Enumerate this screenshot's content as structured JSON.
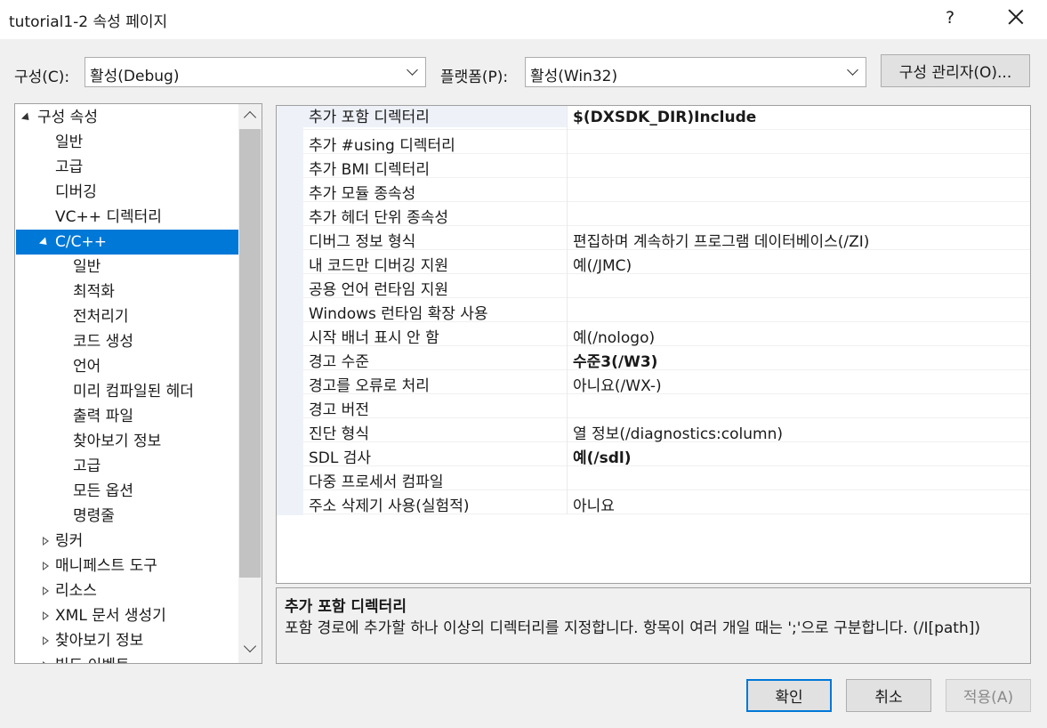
{
  "window": {
    "title": "tutorial1-2 속성 페이지",
    "help_label": "?"
  },
  "config": {
    "config_label": "구성(C):",
    "config_value": "활성(Debug)",
    "platform_label": "플랫폼(P):",
    "platform_value": "활성(Win32)",
    "manager_button": "구성 관리자(O)..."
  },
  "tree": {
    "items": [
      {
        "label": "구성 속성",
        "indent": 0,
        "state": "expanded"
      },
      {
        "label": "일반",
        "indent": 1
      },
      {
        "label": "고급",
        "indent": 1
      },
      {
        "label": "디버깅",
        "indent": 1
      },
      {
        "label": "VC++ 디렉터리",
        "indent": 1
      },
      {
        "label": "C/C++",
        "indent": 1,
        "state": "expanded",
        "selected": true
      },
      {
        "label": "일반",
        "indent": 2
      },
      {
        "label": "최적화",
        "indent": 2
      },
      {
        "label": "전처리기",
        "indent": 2
      },
      {
        "label": "코드 생성",
        "indent": 2
      },
      {
        "label": "언어",
        "indent": 2
      },
      {
        "label": "미리 컴파일된 헤더",
        "indent": 2
      },
      {
        "label": "출력 파일",
        "indent": 2
      },
      {
        "label": "찾아보기 정보",
        "indent": 2
      },
      {
        "label": "고급",
        "indent": 2
      },
      {
        "label": "모든 옵션",
        "indent": 2
      },
      {
        "label": "명령줄",
        "indent": 2
      },
      {
        "label": "링커",
        "indent": 1,
        "state": "collapsed"
      },
      {
        "label": "매니페스트 도구",
        "indent": 1,
        "state": "collapsed"
      },
      {
        "label": "리소스",
        "indent": 1,
        "state": "collapsed"
      },
      {
        "label": "XML 문서 생성기",
        "indent": 1,
        "state": "collapsed"
      },
      {
        "label": "찾아보기 정보",
        "indent": 1,
        "state": "collapsed"
      },
      {
        "label": "빌드 이벤트",
        "indent": 1,
        "state": "collapsed"
      }
    ]
  },
  "properties": [
    {
      "name": "추가 포함 디렉터리",
      "value": "$(DXSDK_DIR)Include",
      "bold": true
    },
    {
      "name": "추가 #using 디렉터리",
      "value": ""
    },
    {
      "name": "추가 BMI 디렉터리",
      "value": ""
    },
    {
      "name": "추가 모듈 종속성",
      "value": ""
    },
    {
      "name": "추가 헤더 단위 종속성",
      "value": ""
    },
    {
      "name": "디버그 정보 형식",
      "value": "편집하며 계속하기 프로그램 데이터베이스(/ZI)"
    },
    {
      "name": "내 코드만 디버깅 지원",
      "value": "예(/JMC)"
    },
    {
      "name": "공용 언어 런타임 지원",
      "value": ""
    },
    {
      "name": "Windows 런타임 확장 사용",
      "value": ""
    },
    {
      "name": "시작 배너 표시 안 함",
      "value": "예(/nologo)"
    },
    {
      "name": "경고 수준",
      "value": "수준3(/W3)",
      "bold": true
    },
    {
      "name": "경고를 오류로 처리",
      "value": "아니요(/WX-)"
    },
    {
      "name": "경고 버전",
      "value": ""
    },
    {
      "name": "진단 형식",
      "value": "열 정보(/diagnostics:column)"
    },
    {
      "name": "SDL 검사",
      "value": "예(/sdl)",
      "bold": true
    },
    {
      "name": "다중 프로세서 컴파일",
      "value": ""
    },
    {
      "name": "주소 삭제기 사용(실험적)",
      "value": "아니요"
    }
  ],
  "description": {
    "title": "추가 포함 디렉터리",
    "text": "포함 경로에 추가할 하나 이상의 디렉터리를 지정합니다. 항목이 여러 개일 때는 ';'으로 구분합니다. (/I[path])"
  },
  "buttons": {
    "ok": "확인",
    "cancel": "취소",
    "apply": "적용(A)"
  },
  "colors": {
    "selection": "#0078d7",
    "gutter": "#eef2f8"
  }
}
